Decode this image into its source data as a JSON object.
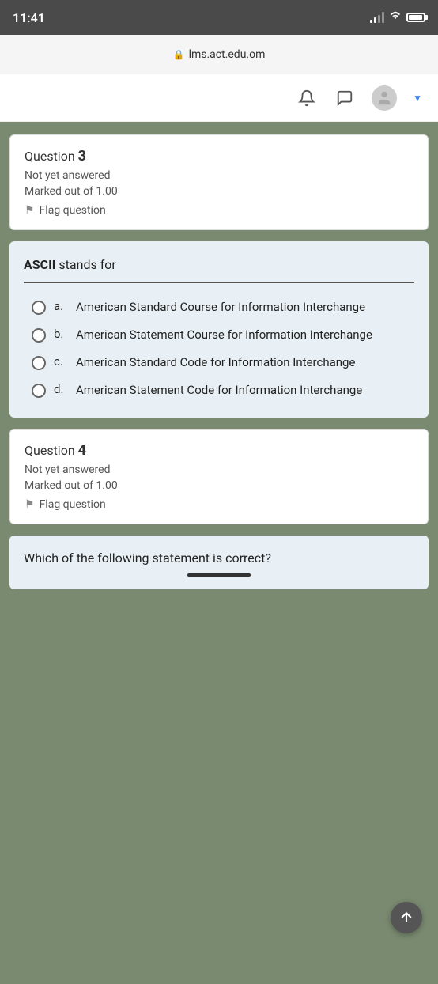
{
  "statusBar": {
    "time": "11:41",
    "url": "lms.act.edu.om"
  },
  "topBar": {
    "bell_label": "Notifications",
    "chat_label": "Messages",
    "avatar_label": "User profile",
    "dropdown_label": "Dropdown"
  },
  "question3": {
    "label": "Question",
    "number": "3",
    "status": "Not yet answered",
    "marked": "Marked out of 1.00",
    "flag": "Flag question"
  },
  "question3Answer": {
    "question_prefix": "ASCII",
    "question_suffix": " stands for",
    "options": [
      {
        "letter": "a.",
        "text": "American Standard Course for Information Interchange"
      },
      {
        "letter": "b.",
        "text": "American Statement Course for Information Interchange"
      },
      {
        "letter": "c.",
        "text": "American Standard Code for Information Interchange"
      },
      {
        "letter": "d.",
        "text": "American Statement Code for Information Interchange"
      }
    ]
  },
  "question4": {
    "label": "Question",
    "number": "4",
    "status": "Not yet answered",
    "marked": "Marked out of 1.00",
    "flag": "Flag question"
  },
  "question4Answer": {
    "question_text": "Which of the following statement is correct?"
  },
  "scrollUp": {
    "label": "Scroll to top"
  }
}
